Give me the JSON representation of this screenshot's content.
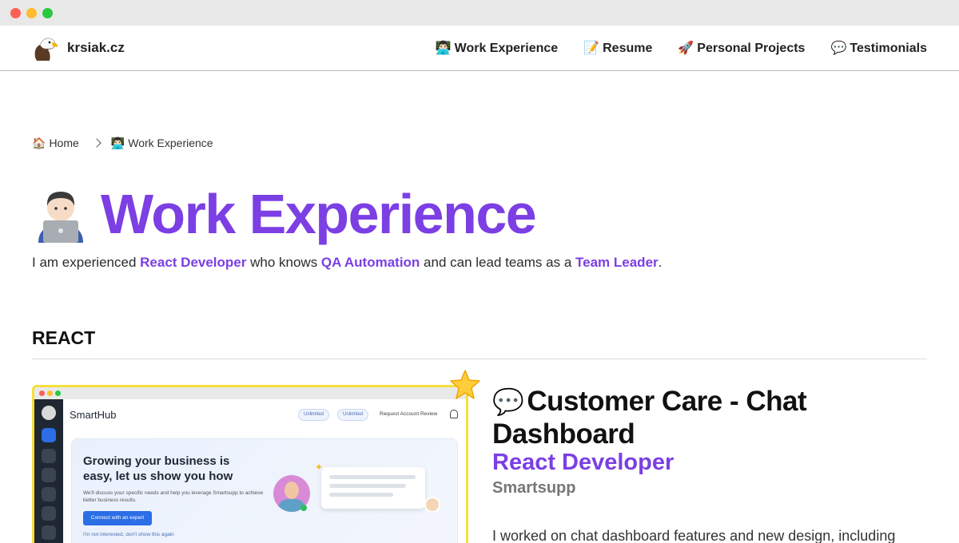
{
  "window": {
    "colors": {
      "close": "#fe5f57",
      "minimize": "#febc2e",
      "zoom": "#28c840"
    }
  },
  "nav": {
    "brand": "krsiak.cz",
    "brand_icon": "bald-eagle-icon",
    "links": [
      {
        "icon": "technologist-icon",
        "emoji": "👨🏻‍💻",
        "label": "Work Experience"
      },
      {
        "icon": "memo-icon",
        "emoji": "📝",
        "label": "Resume"
      },
      {
        "icon": "rocket-icon",
        "emoji": "🚀",
        "label": "Personal Projects"
      },
      {
        "icon": "speech-balloon-icon",
        "emoji": "💬",
        "label": "Testimonials"
      }
    ]
  },
  "breadcrumb": [
    {
      "icon": "house-icon",
      "emoji": "🏠",
      "label": "Home"
    },
    {
      "icon": "technologist-icon",
      "emoji": "👨🏻‍💻",
      "label": "Work Experience"
    }
  ],
  "page": {
    "title": "Work Experience",
    "title_icon": "technologist-laptop-icon",
    "accent": "#7b3fe4",
    "intro": {
      "p1": "I am experienced ",
      "h1": "React Developer",
      "p2": " who knows ",
      "h2": "QA Automation",
      "p3": " and can lead teams as a ",
      "h3": "Team Leader",
      "p4": "."
    }
  },
  "section": {
    "heading": "REACT"
  },
  "card": {
    "featured_icon": "star-icon",
    "title_emoji": "💬",
    "title": "Customer Care - Chat Dashboard",
    "role": "React Developer",
    "company": "Smartsupp",
    "description": "I worked on chat dashboard features and new design, including",
    "screenshot": {
      "app_name": "SmartHub",
      "pill1": "Unlimited",
      "pill2": "Unlimited",
      "request": "Request Account Review",
      "hero_title": "Growing your business is easy, let us show you how",
      "hero_text": "We'll discuss your specific needs and help you leverage Smartsupp to achieve better business results.",
      "cta": "Connect with an expert",
      "dismiss": "I'm not interested, don't show this again"
    }
  }
}
